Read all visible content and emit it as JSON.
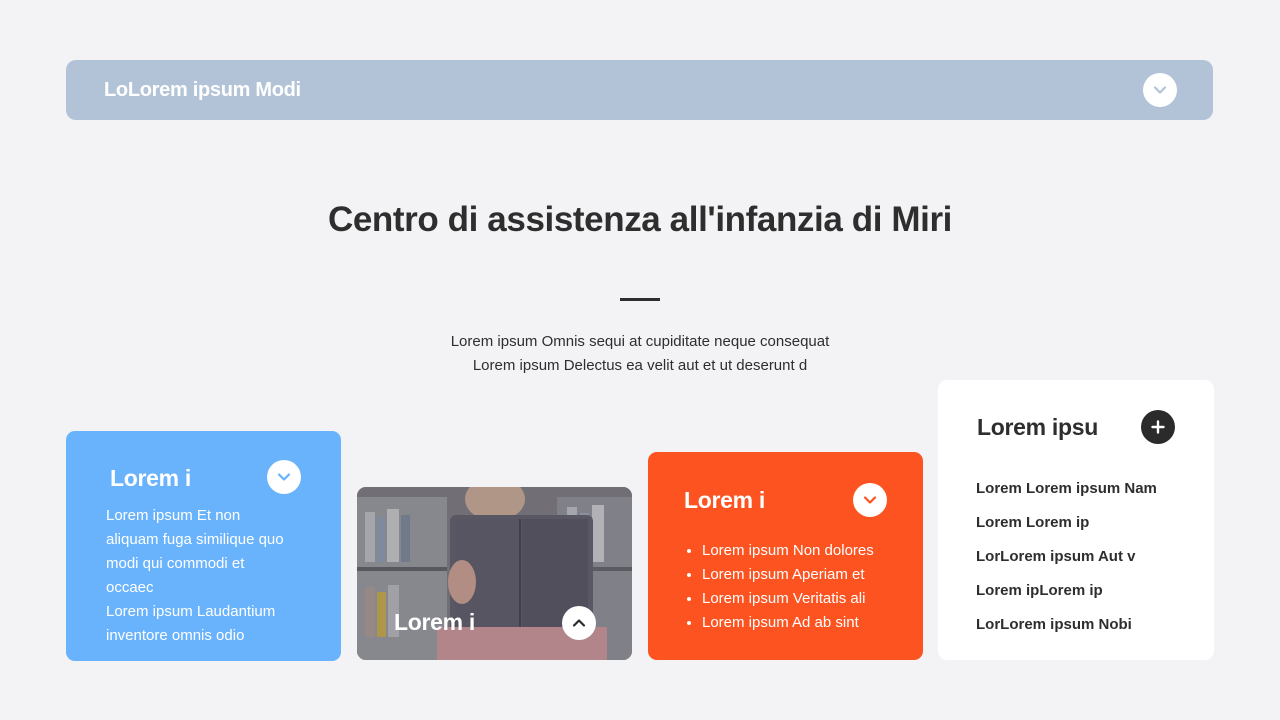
{
  "topbar": {
    "title": "LoLorem ipsum Modi",
    "icon": "chevron-down-icon"
  },
  "heading": "Centro di assistenza all'infanzia di Miri",
  "subtext": [
    "Lorem ipsum Omnis sequi at cupiditate neque consequat",
    "Lorem ipsum Delectus ea velit aut et ut deserunt d"
  ],
  "cards": {
    "blue": {
      "title": "Lorem i",
      "icon": "chevron-down-icon",
      "color": "#69b3fc",
      "lines": [
        "Lorem ipsum Et non",
        "aliquam fuga similique quo",
        "modi qui commodi et",
        "occaec",
        "Lorem ipsum Laudantium",
        "inventore omnis odio"
      ]
    },
    "photo": {
      "title": "Lorem i",
      "icon": "chevron-up-icon"
    },
    "orange": {
      "title": "Lorem i",
      "icon": "chevron-down-icon",
      "color": "#fc5320",
      "items": [
        "Lorem ipsum Non dolores",
        "Lorem ipsum Aperiam et",
        "Lorem ipsum Veritatis ali",
        "Lorem ipsum Ad ab sint"
      ]
    },
    "white": {
      "title": "Lorem ipsu",
      "icon": "plus-icon",
      "links": [
        "Lorem Lorem ipsum Nam",
        "Lorem Lorem ip",
        "LorLorem ipsum Aut v",
        "Lorem ipLorem ip",
        "LorLorem ipsum Nobi"
      ]
    }
  }
}
